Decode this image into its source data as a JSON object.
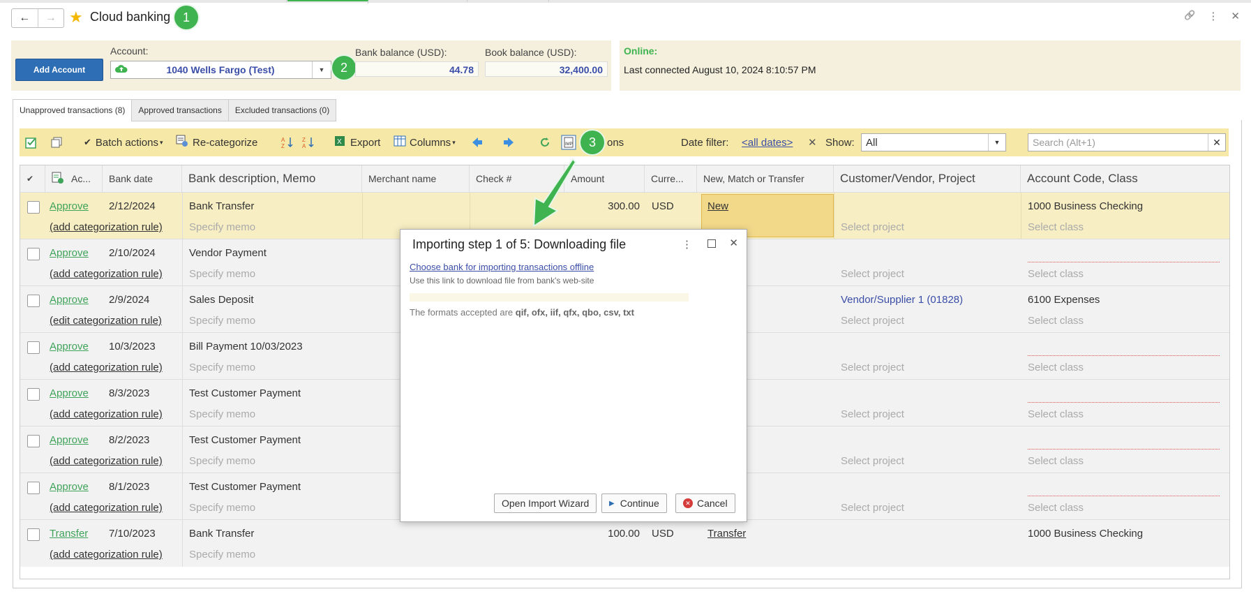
{
  "window": {
    "title": "Cloud banking",
    "back_glyph": "←",
    "forward_glyph": "→",
    "star_glyph": "★",
    "link_glyph": "🔗",
    "more_glyph": "⋮",
    "close_glyph": "✕"
  },
  "callouts": [
    "1",
    "2",
    "3"
  ],
  "header": {
    "add_account_label": "Add Account",
    "account_label": "Account:",
    "account_value": "1040 Wells Fargo (Test)",
    "bank_balance_label": "Bank balance (USD):",
    "bank_balance_value": "44.78",
    "book_balance_label": "Book balance (USD):",
    "book_balance_value": "32,400.00",
    "online_label": "Online:",
    "last_connected": "Last connected August 10, 2024 8:10:57 PM"
  },
  "tabs": [
    {
      "label": "Unapproved transactions (8)",
      "active": true
    },
    {
      "label": "Approved transactions",
      "active": false
    },
    {
      "label": "Excluded transactions (0)",
      "active": false
    }
  ],
  "toolbar": {
    "batch_actions": "Batch actions",
    "recategorize": "Re-categorize",
    "export": "Export",
    "columns": "Columns",
    "actions_partial": "ons",
    "date_filter_label": "Date filter:",
    "date_filter_value": "<all dates>",
    "show_label": "Show:",
    "show_value": "All",
    "search_placeholder": "Search (Alt+1)"
  },
  "columns": {
    "check": "✔",
    "actions": "Ac...",
    "bank_date": "Bank date",
    "bank_desc": "Bank description, Memo",
    "merchant": "Merchant name",
    "check_no": "Check #",
    "amount": "Amount",
    "currency": "Curre...",
    "match": "New, Match or Transfer",
    "customer": "Customer/Vendor, Project",
    "account_code": "Account Code, Class"
  },
  "rows": [
    {
      "action": "Approve",
      "rule": "(add categorization rule)",
      "date": "2/12/2024",
      "desc": "Bank Transfer",
      "memo": "Specify memo",
      "amount": "300.00",
      "currency": "USD",
      "match": "New",
      "customer": "",
      "project": "Select project",
      "account": "1000 Business Checking",
      "class": "Select class"
    },
    {
      "action": "Approve",
      "rule": "(add categorization rule)",
      "date": "2/10/2024",
      "desc": "Vendor Payment",
      "memo": "Specify memo",
      "amount": "",
      "currency": "",
      "match": "",
      "customer": "",
      "project": "Select project",
      "account": "",
      "class": "Select class"
    },
    {
      "action": "Approve",
      "rule": "(edit categorization rule)",
      "date": "2/9/2024",
      "desc": "Sales Deposit",
      "memo": "Specify memo",
      "amount": "",
      "currency": "",
      "match": "",
      "customer": "Vendor/Supplier 1 (01828)",
      "project": "Select project",
      "account": "6100 Expenses",
      "class": "Select class"
    },
    {
      "action": "Approve",
      "rule": "(add categorization rule)",
      "date": "10/3/2023",
      "desc": "Bill Payment 10/03/2023",
      "memo": "Specify memo",
      "amount": "",
      "currency": "",
      "match": "",
      "customer": "",
      "project": "Select project",
      "account": "",
      "class": "Select class"
    },
    {
      "action": "Approve",
      "rule": "(add categorization rule)",
      "date": "8/3/2023",
      "desc": "Test Customer Payment",
      "memo": "Specify memo",
      "amount": "",
      "currency": "",
      "match": "",
      "customer": "",
      "project": "Select project",
      "account": "",
      "class": "Select class"
    },
    {
      "action": "Approve",
      "rule": "(add categorization rule)",
      "date": "8/2/2023",
      "desc": "Test Customer Payment",
      "memo": "Specify memo",
      "amount": "",
      "currency": "",
      "match": "",
      "customer": "",
      "project": "Select project",
      "account": "",
      "class": "Select class"
    },
    {
      "action": "Approve",
      "rule": "(add categorization rule)",
      "date": "8/1/2023",
      "desc": "Test Customer Payment",
      "memo": "Specify memo",
      "amount": "",
      "currency": "",
      "match": "",
      "customer": "",
      "project": "Select project",
      "account": "",
      "class": "Select class"
    },
    {
      "action": "Transfer",
      "rule": "(add categorization rule)",
      "date": "7/10/2023",
      "desc": "Bank Transfer",
      "memo": "Specify memo",
      "amount": "100.00",
      "currency": "USD",
      "match": "Transfer",
      "customer": "",
      "project": "",
      "account": "1000 Business Checking",
      "class": ""
    }
  ],
  "dialog": {
    "title": "Importing step 1 of 5: Downloading file",
    "link": "Choose bank for importing transactions offline",
    "hint": "Use this link to download file from bank's web-site",
    "formats_prefix": "The formats accepted are ",
    "formats": "qif, ofx, iif, qfx, qbo, csv, txt",
    "open_wizard": "Open Import Wizard",
    "continue": "Continue",
    "cancel": "Cancel"
  },
  "colors": {
    "accent_green": "#3fb34f",
    "add_button_blue": "#2e6eb5",
    "toolbar_yellow": "#f6e8a6",
    "link_blue": "#3a4da8"
  }
}
